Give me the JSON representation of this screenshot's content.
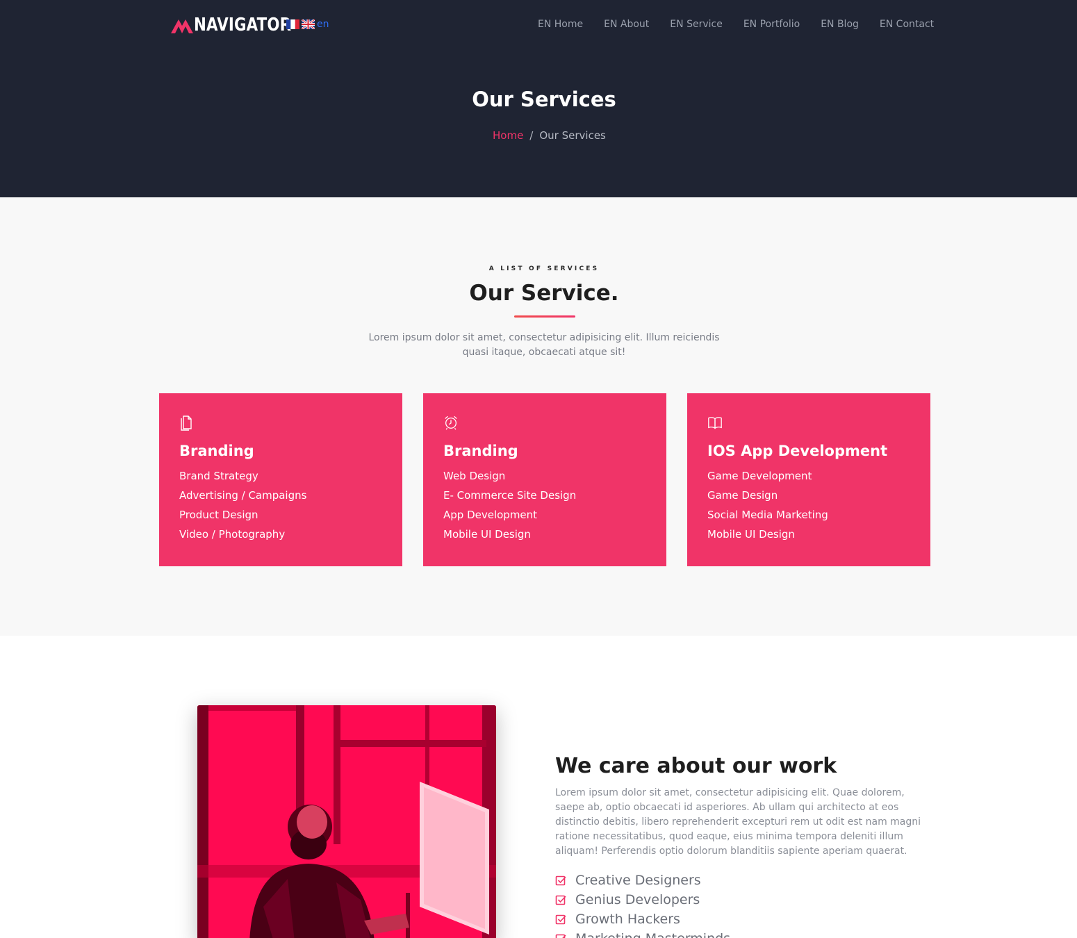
{
  "header": {
    "brand": "NAVIGATOR",
    "language": {
      "current": "en",
      "flags": [
        "fr-flag-icon",
        "uk-flag-icon"
      ]
    },
    "nav": [
      "EN Home",
      "EN About",
      "EN Service",
      "EN Portfolio",
      "EN Blog",
      "EN Contact"
    ]
  },
  "hero": {
    "title": "Our Services",
    "breadcrumb": {
      "home": "Home",
      "separator": "/",
      "current": "Our Services"
    }
  },
  "services": {
    "kicker": "A LIST OF SERVICES",
    "title": "Our Service.",
    "description": "Lorem ipsum dolor sit amet, consectetur adipisicing elit. Illum reiciendis quasi itaque, obcaecati atque sit!",
    "cards": [
      {
        "icon": "document-icon",
        "title": "Branding",
        "items": [
          "Brand Strategy",
          "Advertising / Campaigns",
          "Product Design",
          "Video / Photography"
        ]
      },
      {
        "icon": "alarm-clock-icon",
        "title": "Branding",
        "items": [
          "Web Design",
          "E- Commerce Site Design",
          "App Development",
          "Mobile UI Design"
        ]
      },
      {
        "icon": "open-book-icon",
        "title": "IOS App Development",
        "items": [
          "Game Development",
          "Game Design",
          "Social Media Marketing",
          "Mobile UI Design"
        ]
      }
    ]
  },
  "about": {
    "title": "We care about our work",
    "text": "Lorem ipsum dolor sit amet, consectetur adipisicing elit. Quae dolorem, saepe ab, optio obcaecati id asperiores. Ab ullam qui architecto at eos distinctio debitis, libero reprehenderit excepturi rem ut odit est nam magni ratione necessitatibus, quod eaque, eius minima tempora deleniti illum aliquam! Perferendis optio dolorum blanditiis sapiente aperiam quaerat.",
    "checklist": [
      "Creative Designers",
      "Genius Developers",
      "Growth Hackers",
      "Marketing Masterminds"
    ]
  },
  "colors": {
    "accent": "#f03468",
    "header_bg": "#1f2433",
    "section_bg": "#f8f8f8",
    "link_blue": "#2f6ef6"
  }
}
